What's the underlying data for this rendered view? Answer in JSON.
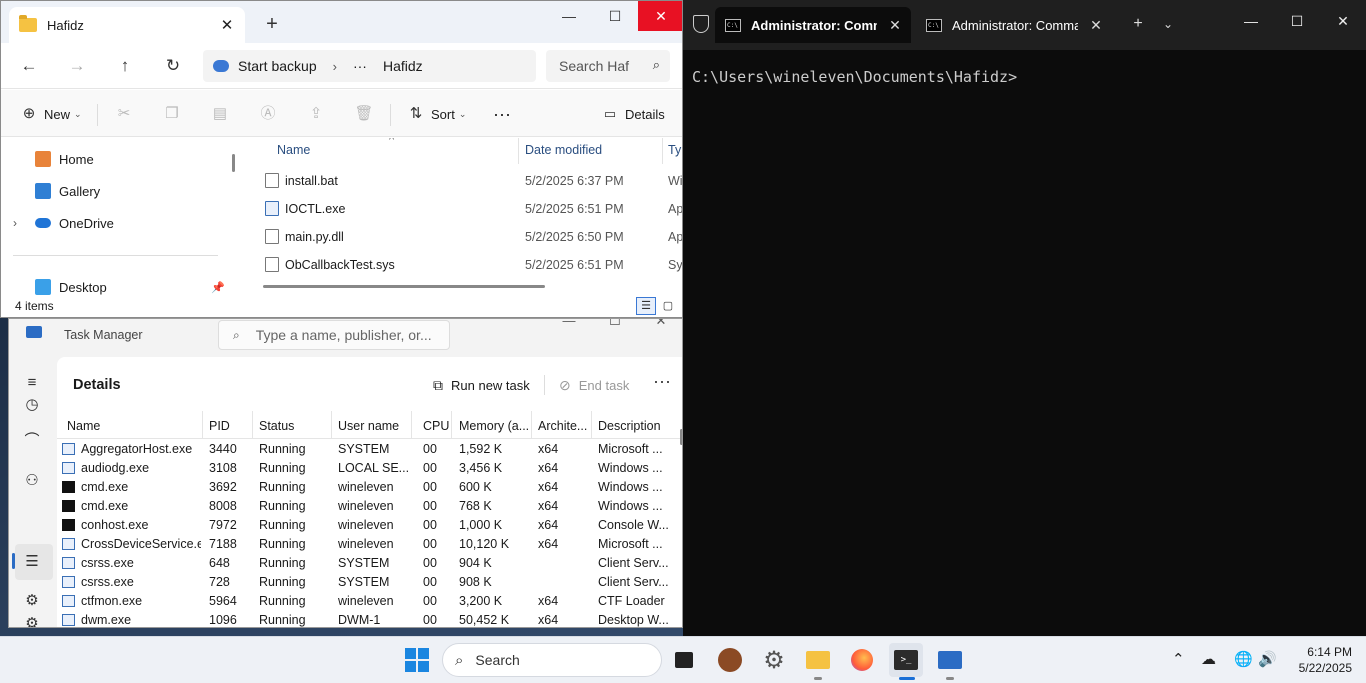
{
  "explorer": {
    "tab_title": "Hafidz",
    "new_tab": "+",
    "breadcrumb": [
      "Start backup",
      "Hafidz"
    ],
    "breadcrumb_ellipsis": "···",
    "search_placeholder": "Search Haf",
    "toolbar": {
      "new": "New",
      "sort": "Sort",
      "details": "Details"
    },
    "nav_items": [
      {
        "label": "Home",
        "icon": "home-icon"
      },
      {
        "label": "Gallery",
        "icon": "gallery-icon"
      },
      {
        "label": "OneDrive",
        "icon": "onedrive-icon"
      },
      {
        "label": "Desktop",
        "icon": "desktop-icon"
      }
    ],
    "columns": {
      "name": "Name",
      "date": "Date modified",
      "type": "Ty"
    },
    "files": [
      {
        "name": "install.bat",
        "date": "5/2/2025 6:37 PM",
        "type": "Wi"
      },
      {
        "name": "IOCTL.exe",
        "date": "5/2/2025 6:51 PM",
        "type": "Ap"
      },
      {
        "name": "main.py.dll",
        "date": "5/2/2025 6:50 PM",
        "type": "Ap"
      },
      {
        "name": "ObCallbackTest.sys",
        "date": "5/2/2025 6:51 PM",
        "type": "Sy"
      }
    ],
    "item_count": "4 items"
  },
  "taskmgr": {
    "title": "Task Manager",
    "search_placeholder": "Type a name, publisher, or...",
    "heading": "Details",
    "run_new_task": "Run new task",
    "end_task": "End task",
    "columns": [
      "Name",
      "PID",
      "Status",
      "User name",
      "CPU",
      "Memory (a...",
      "Archite...",
      "Description"
    ],
    "rows": [
      {
        "name": "AggregatorHost.exe",
        "pid": "3440",
        "status": "Running",
        "user": "SYSTEM",
        "cpu": "00",
        "mem": "1,592 K",
        "arch": "x64",
        "desc": "Microsoft ...",
        "icon": "app"
      },
      {
        "name": "audiodg.exe",
        "pid": "3108",
        "status": "Running",
        "user": "LOCAL SE...",
        "cpu": "00",
        "mem": "3,456 K",
        "arch": "x64",
        "desc": "Windows ...",
        "icon": "app"
      },
      {
        "name": "cmd.exe",
        "pid": "3692",
        "status": "Running",
        "user": "wineleven",
        "cpu": "00",
        "mem": "600 K",
        "arch": "x64",
        "desc": "Windows ...",
        "icon": "cmd"
      },
      {
        "name": "cmd.exe",
        "pid": "8008",
        "status": "Running",
        "user": "wineleven",
        "cpu": "00",
        "mem": "768 K",
        "arch": "x64",
        "desc": "Windows ...",
        "icon": "cmd"
      },
      {
        "name": "conhost.exe",
        "pid": "7972",
        "status": "Running",
        "user": "wineleven",
        "cpu": "00",
        "mem": "1,000 K",
        "arch": "x64",
        "desc": "Console W...",
        "icon": "cmd"
      },
      {
        "name": "CrossDeviceService.e...",
        "pid": "7188",
        "status": "Running",
        "user": "wineleven",
        "cpu": "00",
        "mem": "10,120 K",
        "arch": "x64",
        "desc": "Microsoft ...",
        "icon": "app"
      },
      {
        "name": "csrss.exe",
        "pid": "648",
        "status": "Running",
        "user": "SYSTEM",
        "cpu": "00",
        "mem": "904 K",
        "arch": "",
        "desc": "Client Serv...",
        "icon": "app"
      },
      {
        "name": "csrss.exe",
        "pid": "728",
        "status": "Running",
        "user": "SYSTEM",
        "cpu": "00",
        "mem": "908 K",
        "arch": "",
        "desc": "Client Serv...",
        "icon": "app"
      },
      {
        "name": "ctfmon.exe",
        "pid": "5964",
        "status": "Running",
        "user": "wineleven",
        "cpu": "00",
        "mem": "3,200 K",
        "arch": "x64",
        "desc": "CTF Loader",
        "icon": "app"
      },
      {
        "name": "dwm.exe",
        "pid": "1096",
        "status": "Running",
        "user": "DWM-1",
        "cpu": "00",
        "mem": "50,452 K",
        "arch": "x64",
        "desc": "Desktop W...",
        "icon": "app"
      }
    ]
  },
  "terminal": {
    "tabs": [
      {
        "title": "Administrator: Comma"
      },
      {
        "title": "Administrator: Comma"
      }
    ],
    "prompt": "C:\\Users\\wineleven\\Documents\\Hafidz>"
  },
  "taskbar": {
    "search_label": "Search",
    "time": "6:14 PM",
    "date": "5/22/2025"
  },
  "colors": {
    "accent": "#1a6fd6",
    "close_red": "#e81123",
    "terminal_bg": "#0c0c0c"
  }
}
